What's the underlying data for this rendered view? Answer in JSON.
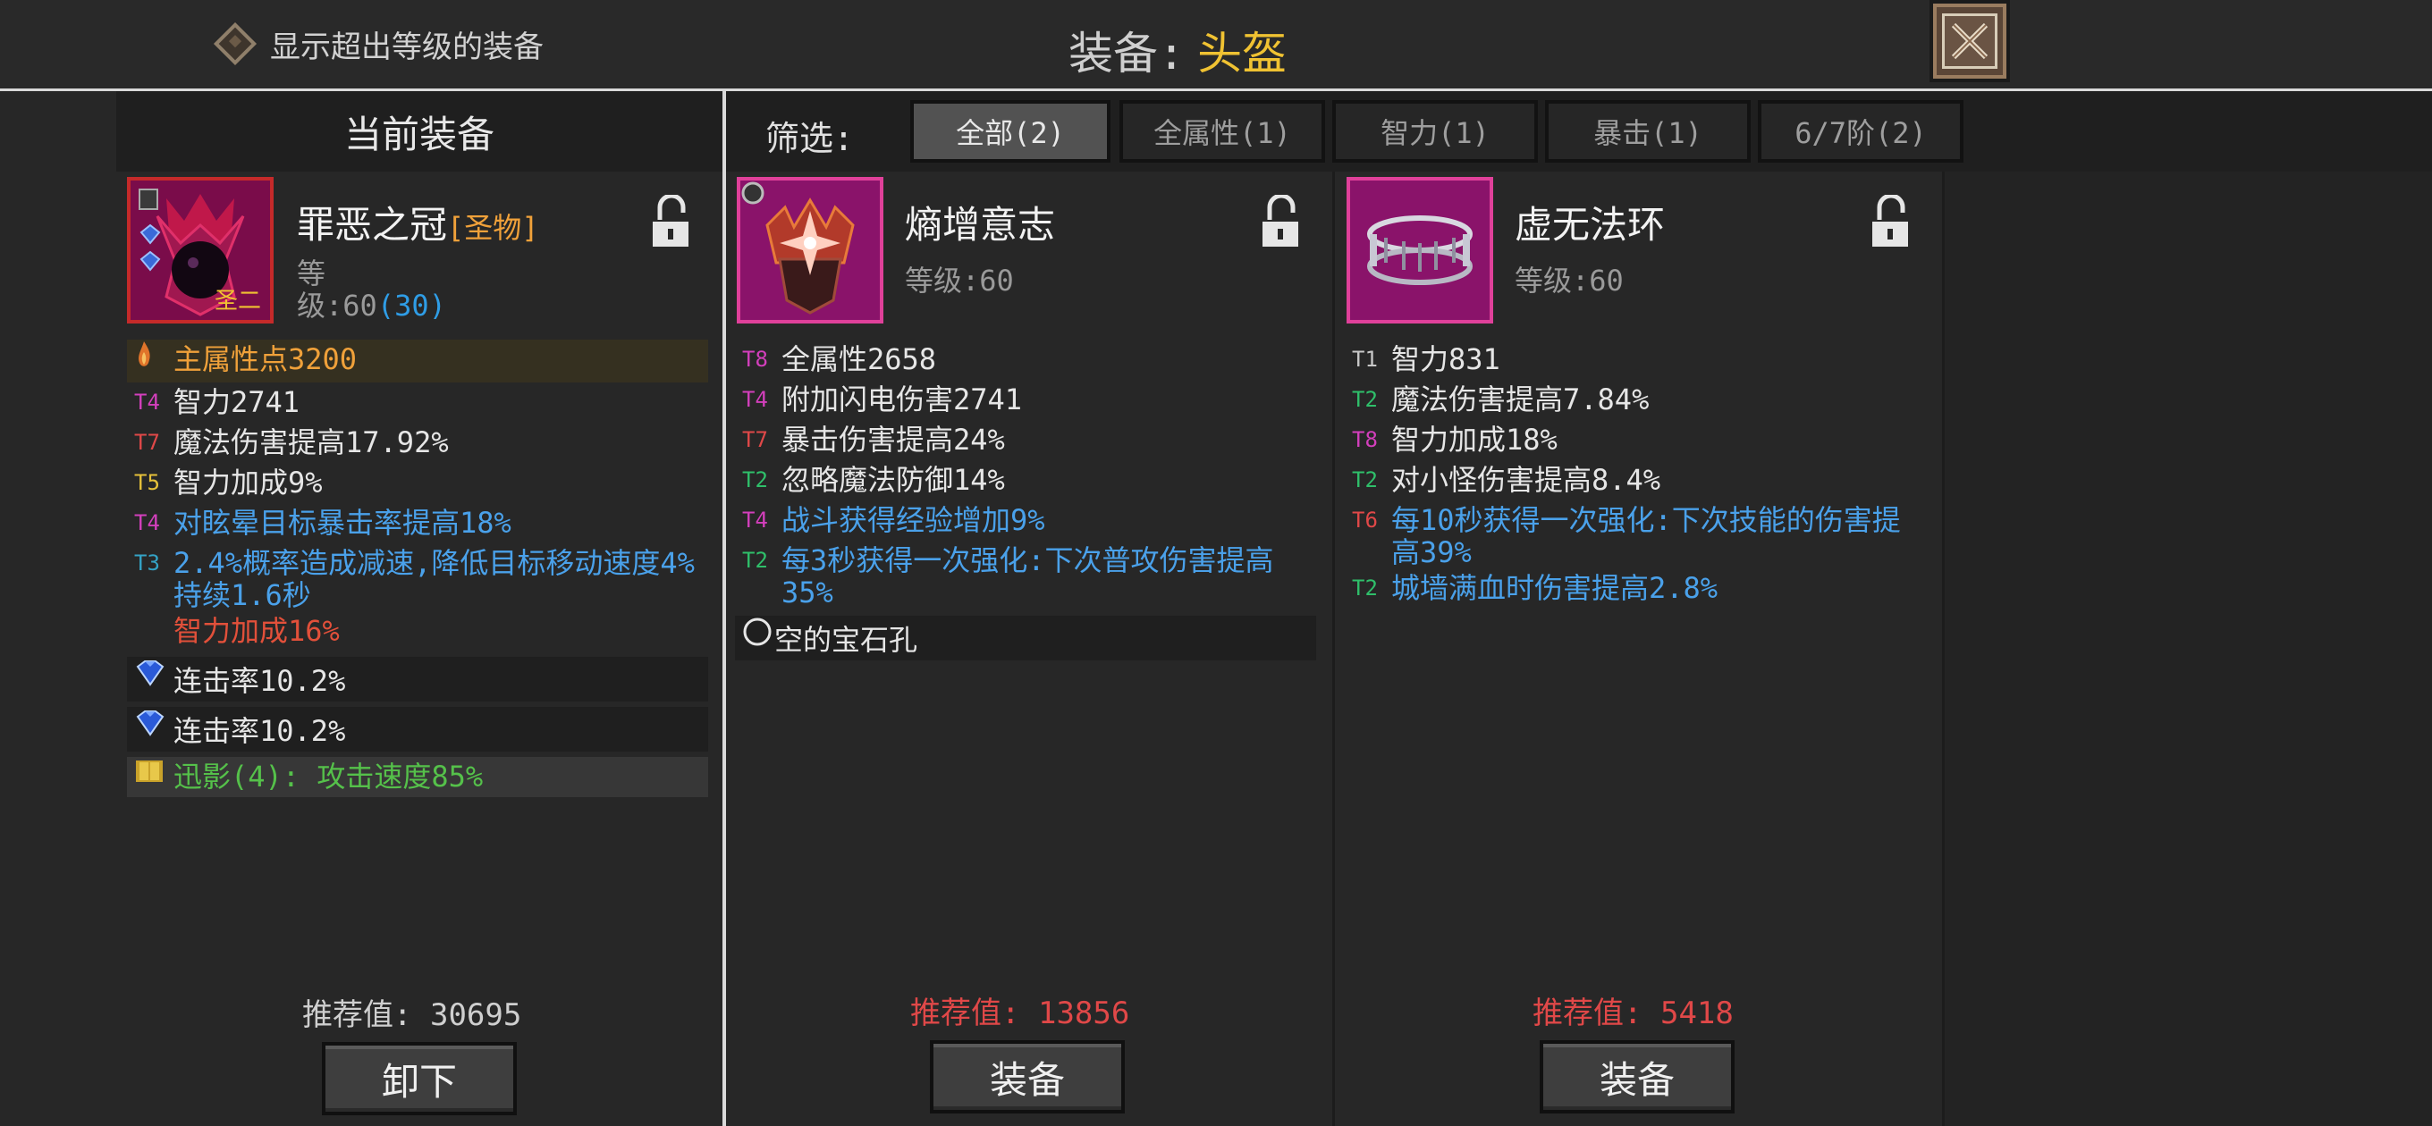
{
  "top": {
    "show_over_level": "显示超出等级的装备",
    "title_prefix": "装备:",
    "slot_name": "头盔"
  },
  "current": {
    "header": "当前装备",
    "name": "罪恶之冠",
    "tag": "[圣物]",
    "level_line1": "等",
    "level_line2": "级:60",
    "level_sub": "(30)",
    "badge": "圣二",
    "main_attr": "主属性点3200",
    "attrs": [
      {
        "tier": "T4",
        "text": "智力2741",
        "tier_color": "pink",
        "color": "white"
      },
      {
        "tier": "T7",
        "text": "魔法伤害提高17.92%",
        "tier_color": "red",
        "color": "white"
      },
      {
        "tier": "T5",
        "text": "智力加成9%",
        "tier_color": "yellow",
        "color": "white"
      },
      {
        "tier": "T4",
        "text": "对眩晕目标暴击率提高18%",
        "tier_color": "pink",
        "color": "blue"
      },
      {
        "tier": "T3",
        "text": "2.4%概率造成减速,降低目标移动速度4%持续1.6秒",
        "tier_color": "cyan",
        "color": "blue"
      },
      {
        "tier": "",
        "text": "智力加成16%",
        "tier_color": "red",
        "color": "red"
      }
    ],
    "gems": [
      "连击率10.2%",
      "连击率10.2%"
    ],
    "set_bonus": "迅影(4): 攻击速度85%",
    "recommend_label": "推荐值:",
    "recommend_value": "30695",
    "action": "卸下"
  },
  "filter": {
    "label": "筛选:",
    "chips": [
      "全部(2)",
      "全属性(1)",
      "智力(1)",
      "暴击(1)",
      "6/7阶(2)"
    ],
    "active_index": 0
  },
  "candidates": [
    {
      "name": "熵增意志",
      "level": "等级:60",
      "attrs": [
        {
          "tier": "T8",
          "text": "全属性2658",
          "tier_color": "pink",
          "color": "white"
        },
        {
          "tier": "T4",
          "text": "附加闪电伤害2741",
          "tier_color": "pink",
          "color": "white"
        },
        {
          "tier": "T7",
          "text": "暴击伤害提高24%",
          "tier_color": "red",
          "color": "white"
        },
        {
          "tier": "T2",
          "text": "忽略魔法防御14%",
          "tier_color": "green",
          "color": "white"
        },
        {
          "tier": "T4",
          "text": "战斗获得经验增加9%",
          "tier_color": "pink",
          "color": "blue"
        },
        {
          "tier": "T2",
          "text": "每3秒获得一次强化:下次普攻伤害提高35%",
          "tier_color": "green",
          "color": "blue"
        }
      ],
      "socket": "空的宝石孔",
      "recommend_label": "推荐值:",
      "recommend_value": "13856",
      "action": "装备"
    },
    {
      "name": "虚无法环",
      "level": "等级:60",
      "attrs": [
        {
          "tier": "T1",
          "text": "智力831",
          "tier_color": "gray",
          "color": "white"
        },
        {
          "tier": "T2",
          "text": "魔法伤害提高7.84%",
          "tier_color": "green",
          "color": "white"
        },
        {
          "tier": "T8",
          "text": "智力加成18%",
          "tier_color": "pink",
          "color": "white"
        },
        {
          "tier": "T2",
          "text": "对小怪伤害提高8.4%",
          "tier_color": "green",
          "color": "white"
        },
        {
          "tier": "T6",
          "text": "每10秒获得一次强化:下次技能的伤害提高39%",
          "tier_color": "red",
          "color": "blue"
        },
        {
          "tier": "T2",
          "text": "城墙满血时伤害提高2.8%",
          "tier_color": "green",
          "color": "blue"
        }
      ],
      "recommend_label": "推荐值:",
      "recommend_value": "5418",
      "action": "装备"
    }
  ],
  "colors": {
    "accent_gold": "#f0c232",
    "rare_pink": "#e0409a",
    "recommend_low": "#e04848"
  }
}
